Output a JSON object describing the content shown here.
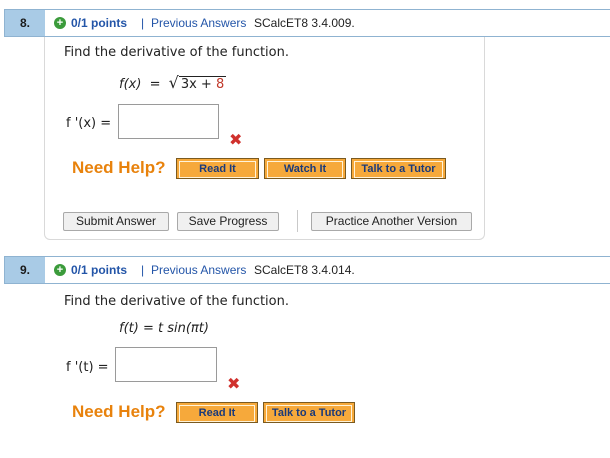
{
  "q8": {
    "number": "8.",
    "points": "0/1 points",
    "separator": "|",
    "previous_answers": "Previous Answers",
    "code": "SCalcET8 3.4.009.",
    "prompt": "Find the derivative of the function.",
    "func_lhs": "f(x)",
    "equals": "=",
    "radicand_main": "3x + ",
    "radicand_const": "8",
    "answer_label": "f '(x)  =",
    "answer_value": "",
    "wrong_mark": "✖",
    "need_help": "Need Help?",
    "help_buttons": [
      "Read It",
      "Watch It",
      "Talk to a Tutor"
    ],
    "submit": "Submit Answer",
    "save": "Save Progress",
    "practice": "Practice Another Version"
  },
  "q9": {
    "number": "9.",
    "points": "0/1 points",
    "separator": "|",
    "previous_answers": "Previous Answers",
    "code": "SCalcET8 3.4.014.",
    "prompt": "Find the derivative of the function.",
    "func": "f(t)  =  t sin(πt)",
    "answer_label": "f '(t)  =",
    "answer_value": "",
    "wrong_mark": "✖",
    "need_help": "Need Help?",
    "help_buttons": [
      "Read It",
      "Talk to a Tutor"
    ]
  },
  "colors": {
    "header_bg": "#a9cbe6",
    "link": "#2355a8",
    "help_orange": "#e8820c",
    "error_red": "#d0312d"
  },
  "icons": {
    "points_status": "plus-circle-icon",
    "wrong": "x-mark-icon",
    "sqrt": "square-root-symbol"
  }
}
